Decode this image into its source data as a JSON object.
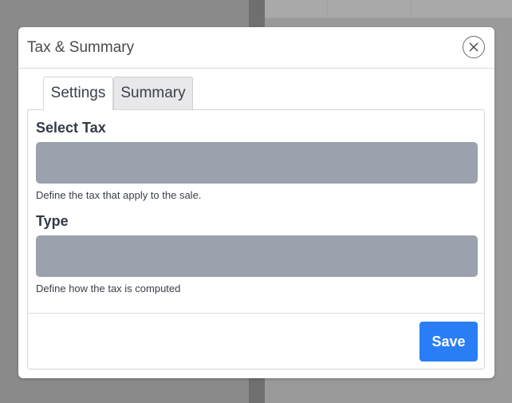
{
  "modal": {
    "title": "Tax & Summary",
    "close_icon": "close-icon"
  },
  "tabs": [
    {
      "label": "Settings",
      "active": true
    },
    {
      "label": "Summary",
      "active": false
    }
  ],
  "form": {
    "tax": {
      "label": "Select Tax",
      "value": "",
      "help": "Define the tax that apply to the sale."
    },
    "type": {
      "label": "Type",
      "value": "",
      "help": "Define how the tax is computed"
    }
  },
  "footer": {
    "save_label": "Save"
  },
  "colors": {
    "accent": "#2a7ef5",
    "select_fill": "#9ba1ad",
    "overlay": "#8a8a8a"
  }
}
